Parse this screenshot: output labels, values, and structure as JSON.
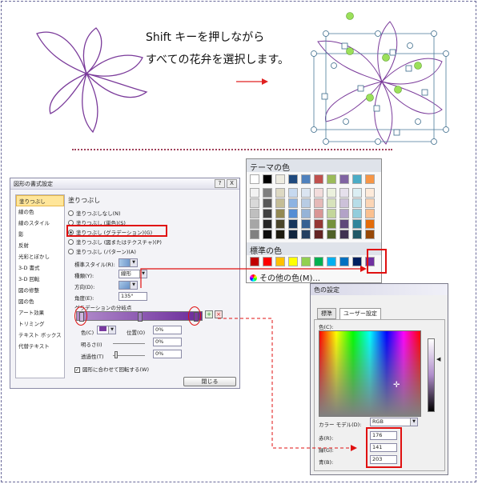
{
  "caption": {
    "line1": "Shift キーを押しながら",
    "line2": "すべての花弁を選択します。"
  },
  "format_dialog": {
    "title": "図形の書式設定",
    "title_buttons": [
      "?",
      "X"
    ],
    "nav_items": [
      "塗りつぶし",
      "線の色",
      "線のスタイル",
      "影",
      "反射",
      "光彩とぼかし",
      "3-D 書式",
      "3-D 回転",
      "図の修整",
      "図の色",
      "アート効果",
      "トリミング",
      "テキスト ボックス",
      "代替テキスト"
    ],
    "section": "塗りつぶし",
    "options": [
      "塗りつぶしなし(N)",
      "塗りつぶし (単色)(S)",
      "塗りつぶし (グラデーション)(G)",
      "塗りつぶし (図またはテクスチャ)(P)",
      "塗りつぶし (パターン)(A)"
    ],
    "preset_label": "標準スタイル(R):",
    "type_label": "種類(Y):",
    "type_value": "線形",
    "direction_label": "方向(D):",
    "angle_label": "角度(E):",
    "angle_value": "135°",
    "stops_label": "グラデーションの分岐点",
    "color_label": "色(C)",
    "position_label": "位置(O)",
    "position_value": "0%",
    "brightness_label": "明るさ(I)",
    "brightness_value": "0%",
    "transparency_label": "透過性(T)",
    "transparency_value": "0%",
    "rotate_label": "図形に合わせて回転する(W)",
    "close_label": "閉じる"
  },
  "theme_palette": {
    "theme_header": "テーマの色",
    "standard_header": "標準の色",
    "more_colors": "その他の色(M)...",
    "theme_top": [
      "#ffffff",
      "#000000",
      "#eeece1",
      "#1f497d",
      "#4f81bd",
      "#c0504d",
      "#9bbb59",
      "#8064a2",
      "#4bacc6",
      "#f79646"
    ],
    "theme_cols": [
      [
        "#f2f2f2",
        "#d9d9d9",
        "#bfbfbf",
        "#a6a6a6",
        "#808080"
      ],
      [
        "#7f7f7f",
        "#595959",
        "#404040",
        "#262626",
        "#0d0d0d"
      ],
      [
        "#ddd9c3",
        "#c4bd97",
        "#938953",
        "#4a452a",
        "#1d1b10"
      ],
      [
        "#c6d9f0",
        "#8db3e2",
        "#548dd4",
        "#17365d",
        "#0f243e"
      ],
      [
        "#dbe5f1",
        "#b8cce4",
        "#95b3d7",
        "#366092",
        "#244061"
      ],
      [
        "#f2dcdb",
        "#e5b9b7",
        "#d99694",
        "#953734",
        "#632423"
      ],
      [
        "#ebf1dd",
        "#d7e3bc",
        "#c3d69b",
        "#76923c",
        "#4f6128"
      ],
      [
        "#e5e0ec",
        "#ccc1d9",
        "#b2a2c7",
        "#5f497a",
        "#3f3151"
      ],
      [
        "#dbeef3",
        "#b7dde8",
        "#92cddc",
        "#31859b",
        "#205867"
      ],
      [
        "#fdeada",
        "#fbd5b5",
        "#fac08f",
        "#e36c09",
        "#974806"
      ]
    ],
    "standard": [
      "#c00000",
      "#ff0000",
      "#ffc000",
      "#ffff00",
      "#92d050",
      "#00b050",
      "#00b0f0",
      "#0070c0",
      "#002060",
      "#7030a0"
    ]
  },
  "color_dialog": {
    "title": "色の設定",
    "tabs": [
      "標準",
      "ユーザー設定"
    ],
    "colors_label": "色(C):",
    "model_label": "カラー モデル(D):",
    "model_value": "RGB",
    "red_label": "赤(R):",
    "red": "176",
    "green_label": "緑(G):",
    "green": "141",
    "blue_label": "青(B):",
    "blue": "203"
  }
}
